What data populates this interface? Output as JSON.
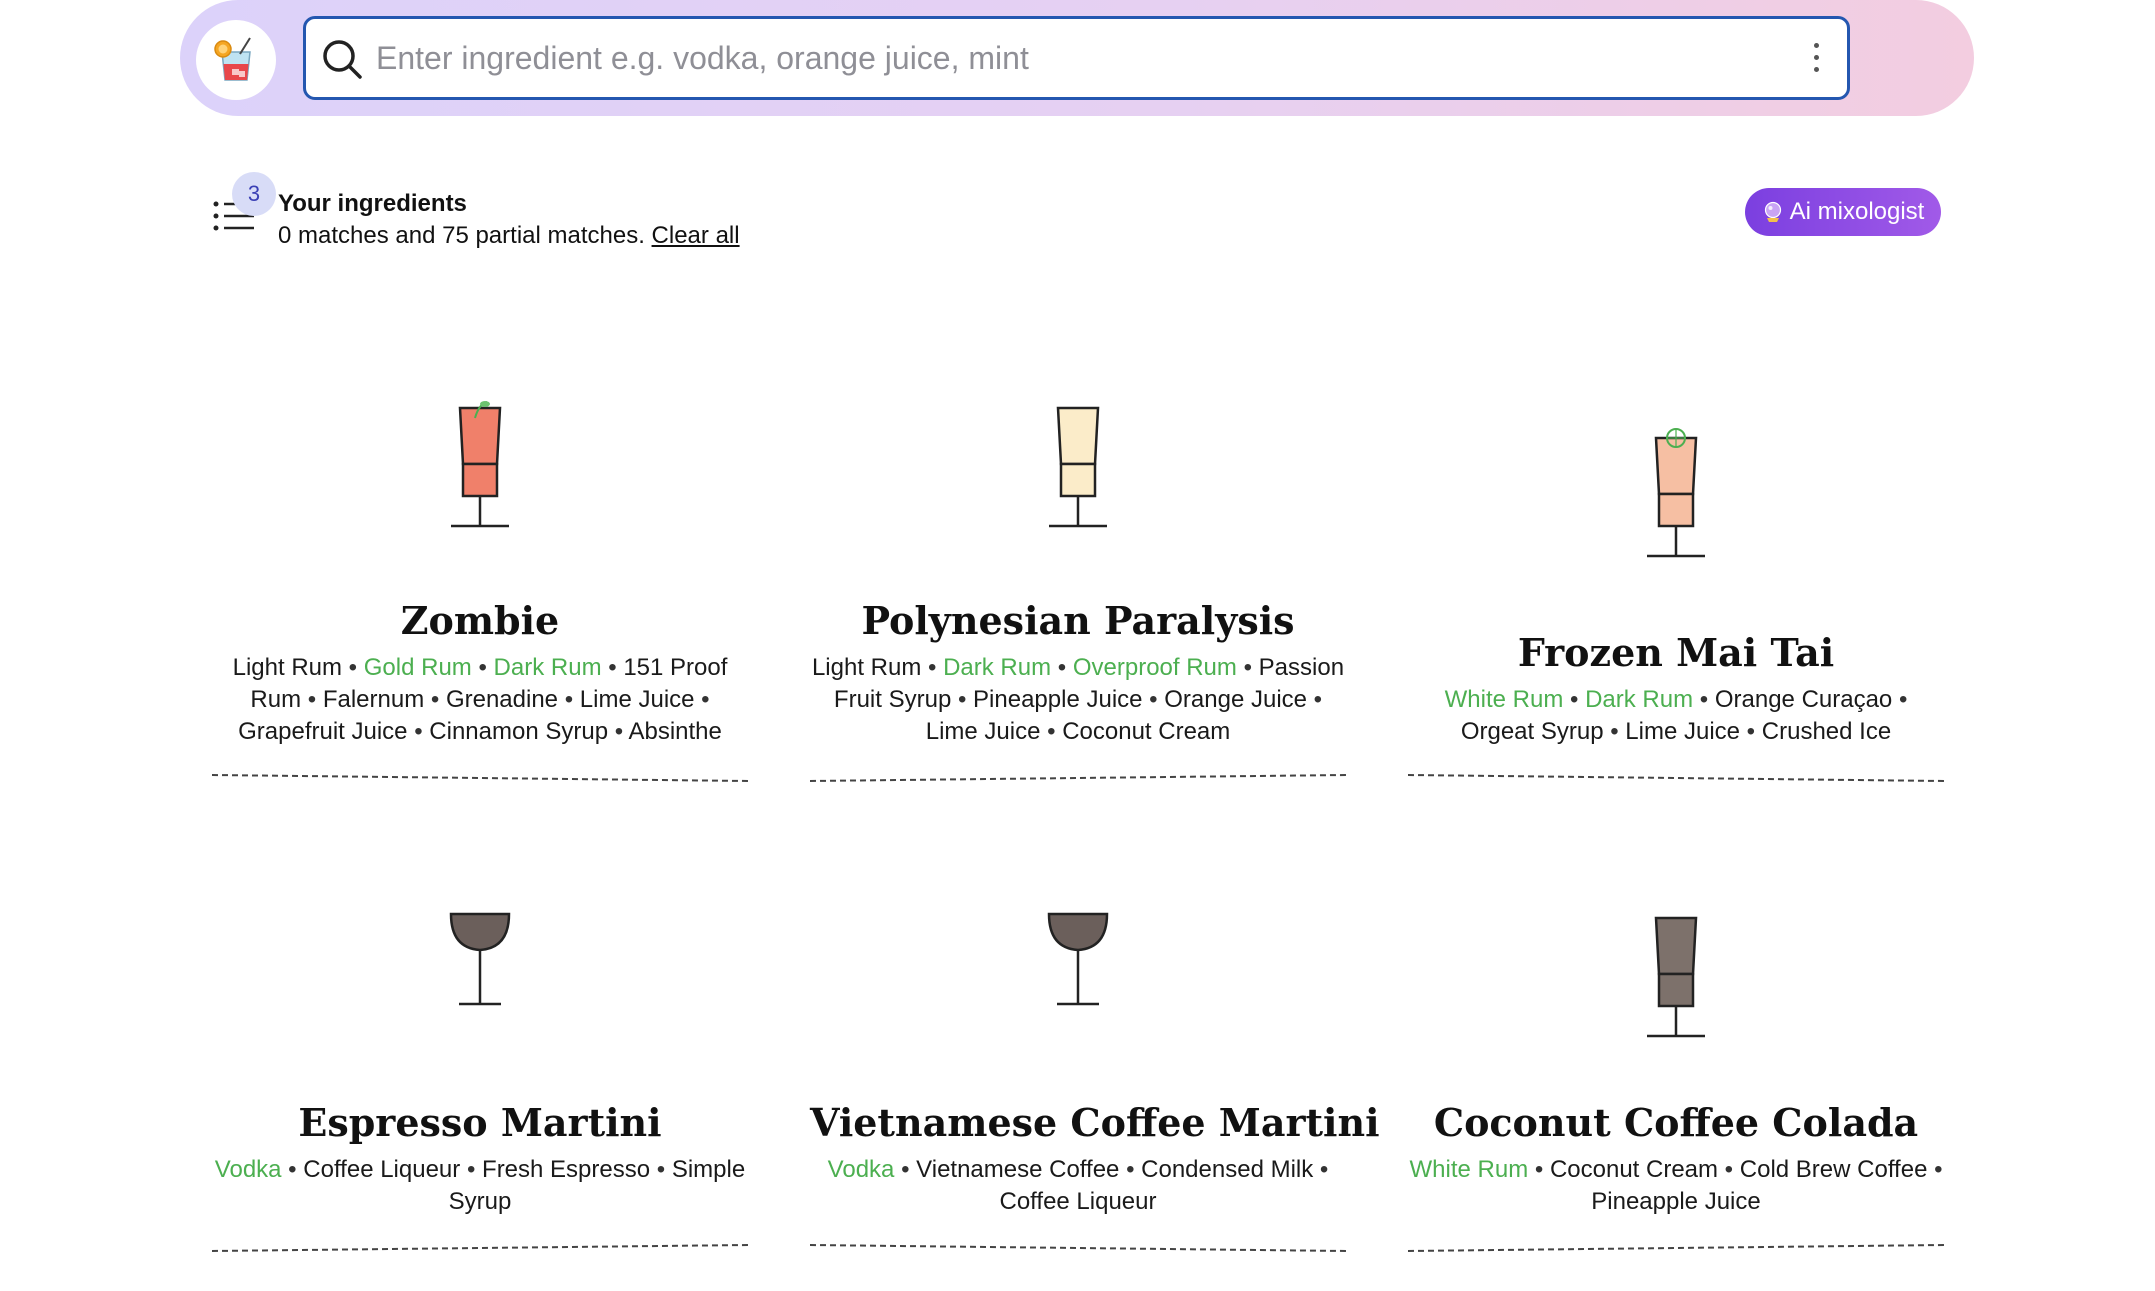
{
  "search": {
    "placeholder": "Enter ingredient e.g. vodka, orange juice, mint"
  },
  "ingredients_panel": {
    "count": "3",
    "title": "Your ingredients",
    "summary": "0 matches and 75 partial matches.",
    "clear_label": "Clear all"
  },
  "mixologist": {
    "label": "Ai mixologist"
  },
  "colors": {
    "accent_blue": "#2457b0",
    "match_green": "#4caf50",
    "mixologist_purple": "#7b3fe0"
  },
  "cocktails": [
    {
      "name": "Zombie",
      "glass": "highball-stem",
      "liquid_color": "#f0806a",
      "garnish": "mint-sprig",
      "ingredients": [
        {
          "name": "Light Rum",
          "match": false
        },
        {
          "name": "Gold Rum",
          "match": true
        },
        {
          "name": "Dark Rum",
          "match": true
        },
        {
          "name": "151 Proof Rum",
          "match": false
        },
        {
          "name": "Falernum",
          "match": false
        },
        {
          "name": "Grenadine",
          "match": false
        },
        {
          "name": "Lime Juice",
          "match": false
        },
        {
          "name": "Grapefruit Juice",
          "match": false
        },
        {
          "name": "Cinnamon Syrup",
          "match": false
        },
        {
          "name": "Absinthe",
          "match": false
        }
      ]
    },
    {
      "name": "Polynesian Paralysis",
      "glass": "highball-stem",
      "liquid_color": "#fbecc9",
      "garnish": "none",
      "ingredients": [
        {
          "name": "Light Rum",
          "match": false
        },
        {
          "name": "Dark Rum",
          "match": true
        },
        {
          "name": "Overproof Rum",
          "match": true
        },
        {
          "name": "Passion Fruit Syrup",
          "match": false
        },
        {
          "name": "Pineapple Juice",
          "match": false
        },
        {
          "name": "Orange Juice",
          "match": false
        },
        {
          "name": "Lime Juice",
          "match": false
        },
        {
          "name": "Coconut Cream",
          "match": false
        }
      ]
    },
    {
      "name": "Frozen Mai Tai",
      "glass": "highball-stem",
      "liquid_color": "#f6bfa3",
      "garnish": "lime-wheel",
      "ingredients": [
        {
          "name": "White Rum",
          "match": true
        },
        {
          "name": "Dark Rum",
          "match": true
        },
        {
          "name": "Orange Curaçao",
          "match": false
        },
        {
          "name": "Orgeat Syrup",
          "match": false
        },
        {
          "name": "Lime Juice",
          "match": false
        },
        {
          "name": "Crushed Ice",
          "match": false
        }
      ]
    },
    {
      "name": "Espresso Martini",
      "glass": "coupe",
      "liquid_color": "#6b5f5b",
      "garnish": "none",
      "ingredients": [
        {
          "name": "Vodka",
          "match": true
        },
        {
          "name": "Coffee Liqueur",
          "match": false
        },
        {
          "name": "Fresh Espresso",
          "match": false
        },
        {
          "name": "Simple Syrup",
          "match": false
        }
      ]
    },
    {
      "name": "Vietnamese Coffee Martini",
      "glass": "coupe",
      "liquid_color": "#6b5f5b",
      "garnish": "none",
      "ingredients": [
        {
          "name": "Vodka",
          "match": true
        },
        {
          "name": "Vietnamese Coffee",
          "match": false
        },
        {
          "name": "Condensed Milk",
          "match": false
        },
        {
          "name": "Coffee Liqueur",
          "match": false
        }
      ]
    },
    {
      "name": "Coconut Coffee Colada",
      "glass": "highball-stem",
      "liquid_color": "#7d716b",
      "garnish": "none",
      "ingredients": [
        {
          "name": "White Rum",
          "match": true
        },
        {
          "name": "Coconut Cream",
          "match": false
        },
        {
          "name": "Cold Brew Coffee",
          "match": false
        },
        {
          "name": "Pineapple Juice",
          "match": false
        }
      ]
    }
  ]
}
